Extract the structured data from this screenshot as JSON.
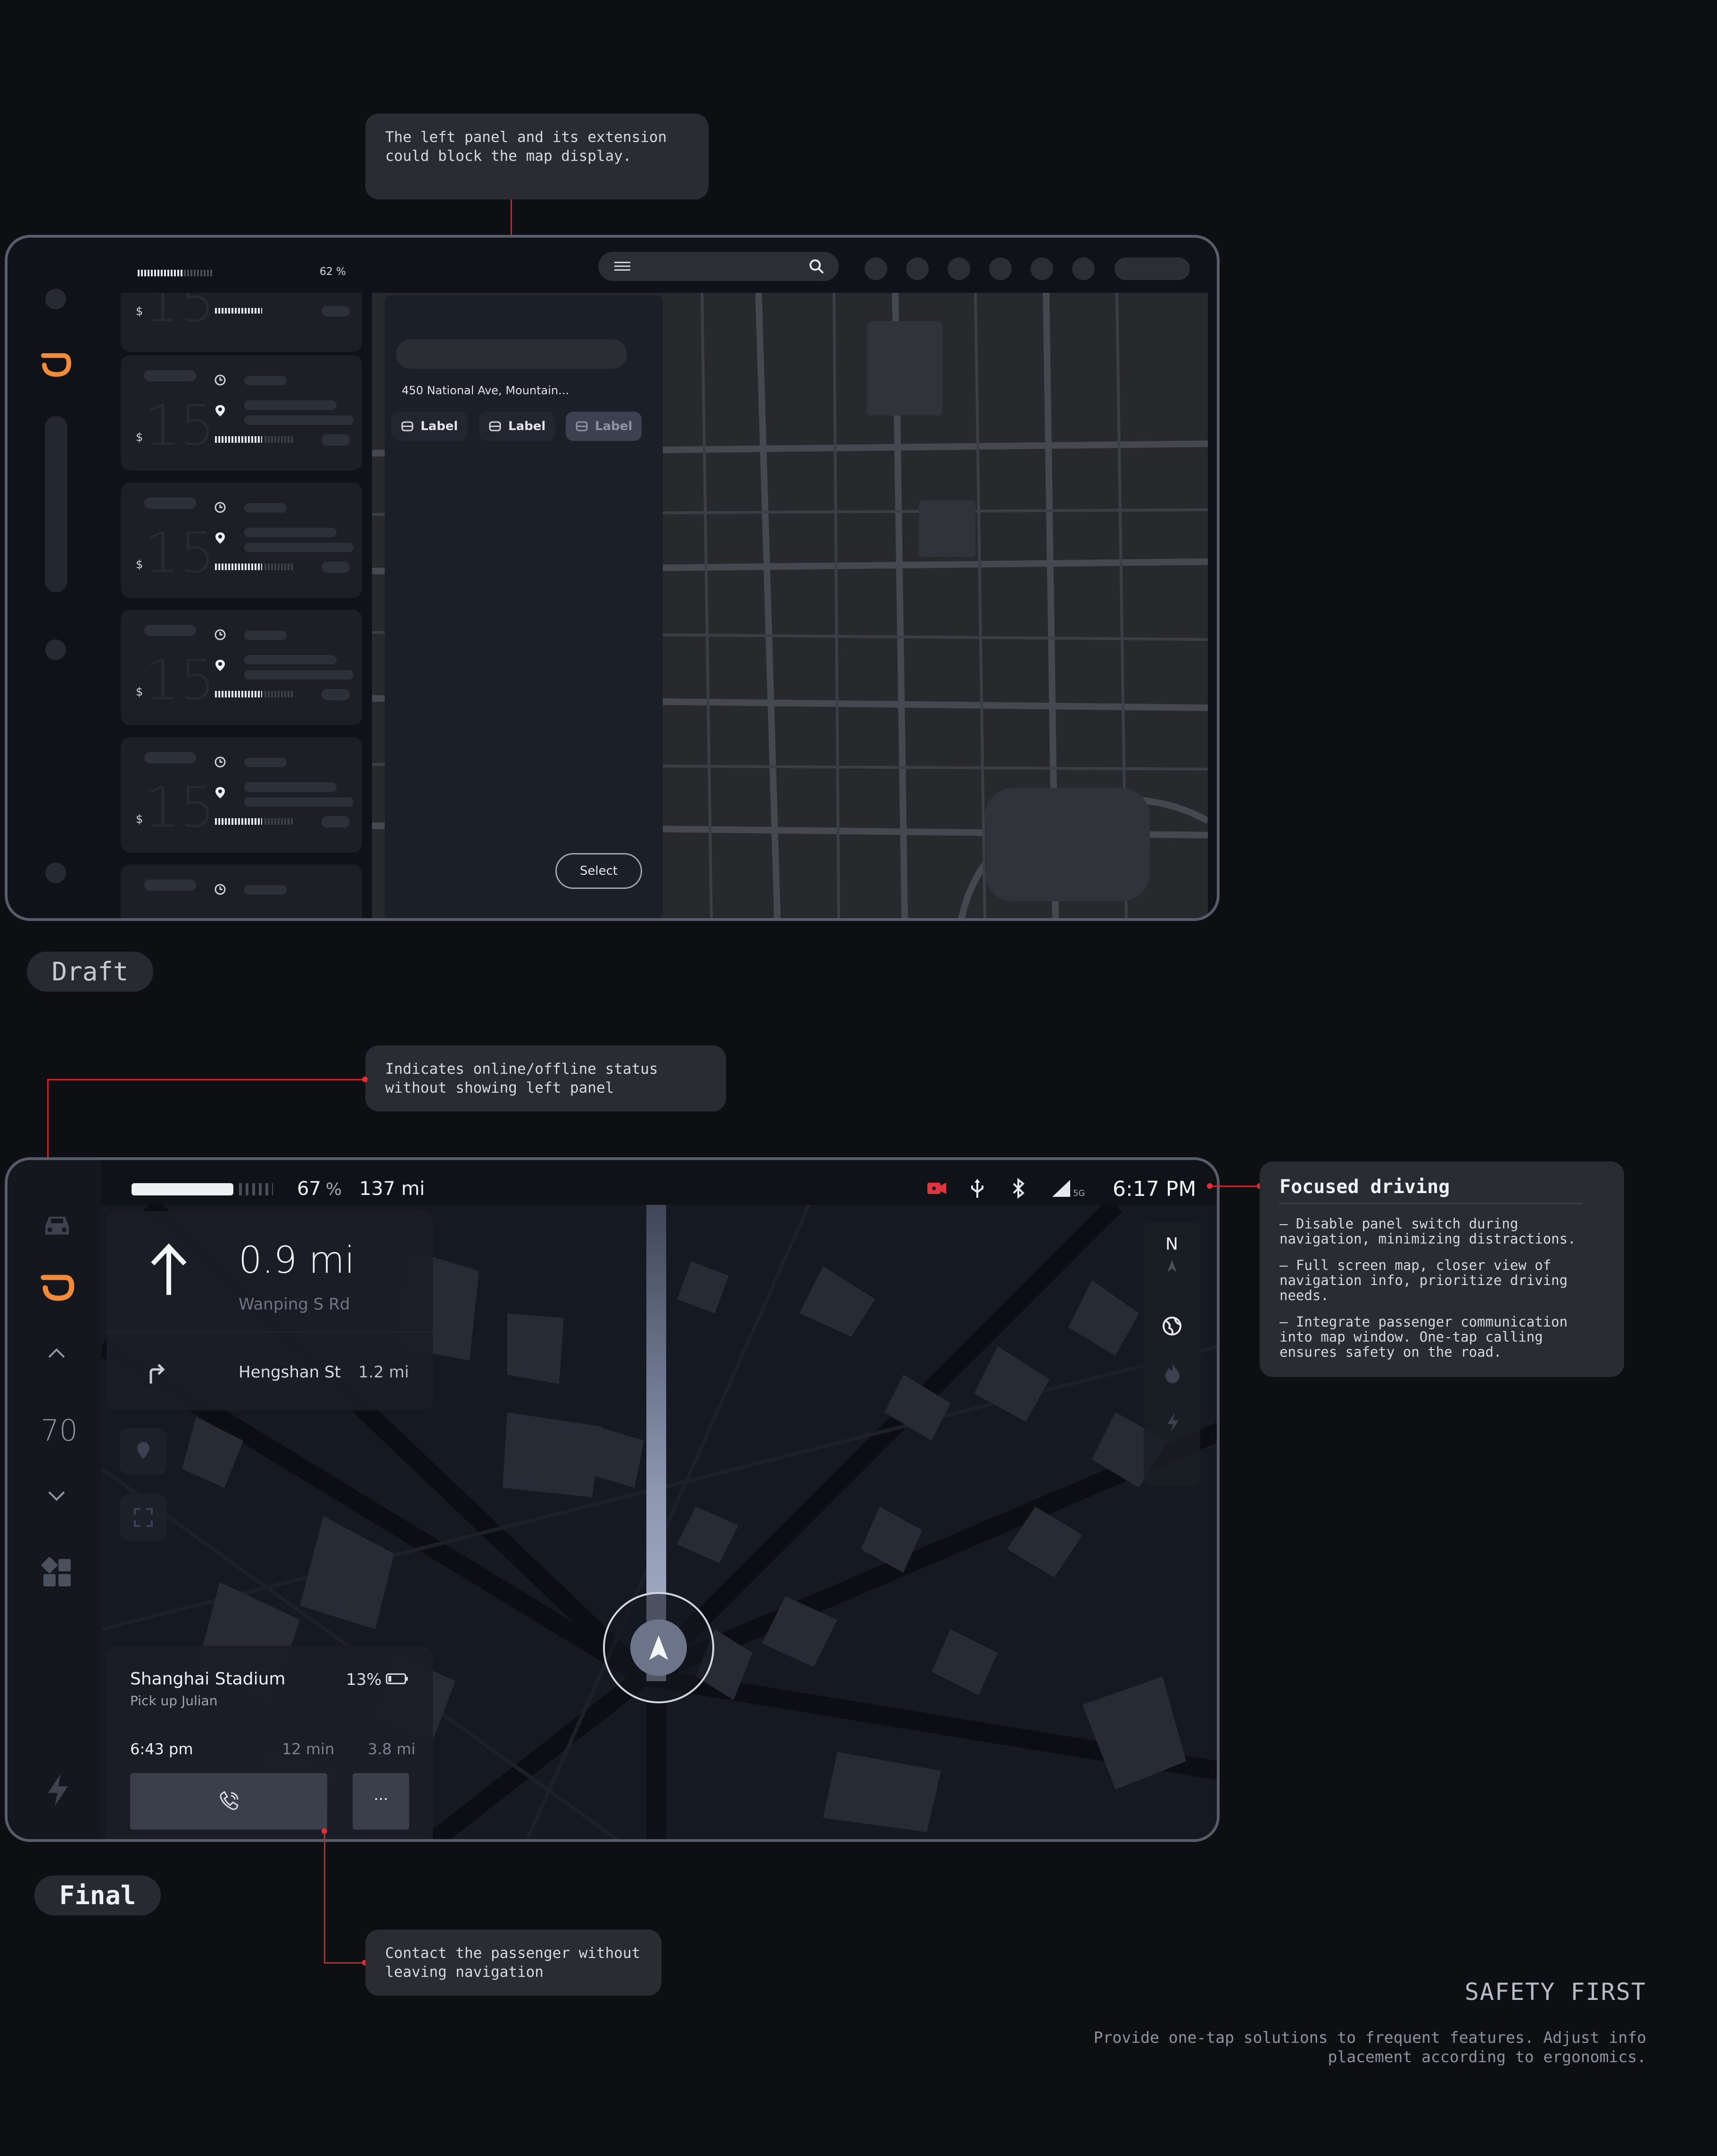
{
  "draft": {
    "annotation": "The left panel and its extension could block the map display.",
    "battery_percent": "62 %",
    "trip_cards": [
      {
        "minutes": "15",
        "currency": "$"
      },
      {
        "minutes": "15",
        "currency": "$"
      },
      {
        "minutes": "15",
        "currency": "$"
      },
      {
        "minutes": "15",
        "currency": "$"
      },
      {
        "minutes": "15",
        "currency": "$"
      }
    ],
    "address": "450 National Ave, Mountain...",
    "chips": [
      "Label",
      "Label",
      "Label"
    ],
    "select_button": "Select",
    "tag": "Draft"
  },
  "final": {
    "annotation_top": "Indicates online/offline status without showing left panel",
    "annotation_bottom": "Contact the passenger without leaving navigation",
    "status": {
      "battery_percent": "67",
      "battery_unit": "%",
      "battery_level": 0.67,
      "range": "137 mi",
      "network": "5G",
      "time": "6:17 PM"
    },
    "sidebar": {
      "speed": "70"
    },
    "navigation": {
      "distance": "0.9 mi",
      "current_road": "Wanping S Rd",
      "next_street": "Hengshan St",
      "next_distance": "1.2 mi"
    },
    "compass": "N",
    "trip": {
      "destination": "Shanghai Stadium",
      "task": "Pick up Julian",
      "battery": "13%",
      "arrival": "6:43 pm",
      "duration": "12 min",
      "distance": "3.8 mi",
      "more_label": "···"
    },
    "tag": "Final"
  },
  "focused_driving": {
    "title": "Focused driving",
    "points": [
      "– Disable panel switch during navigation, minimizing distractions.",
      "– Full screen map, closer view of navigation info, prioritize driving needs.",
      "– Integrate passenger communication into map window. One-tap calling ensures safety on the road."
    ]
  },
  "footer": {
    "heading": "SAFETY FIRST",
    "text": "Provide one-tap solutions to frequent features. Adjust info placement according to ergonomics."
  },
  "colors": {
    "accent": "#f28a3c",
    "alert": "#e0353f",
    "background": "#0d0f13"
  }
}
